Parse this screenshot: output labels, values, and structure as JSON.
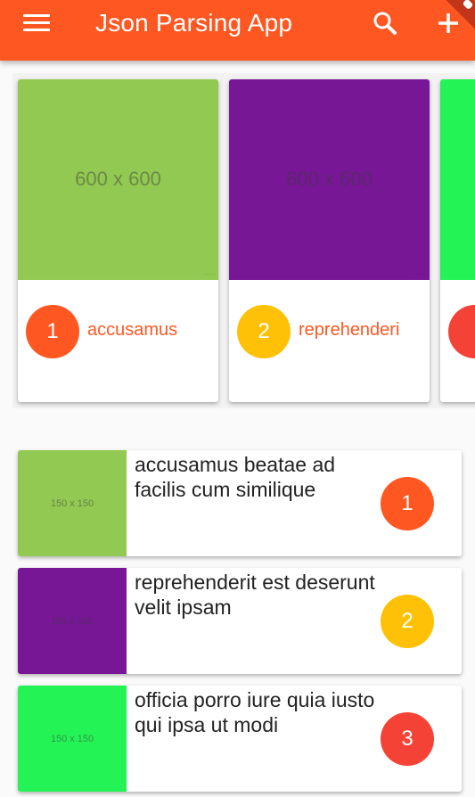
{
  "app_bar": {
    "title": "Json Parsing App",
    "background_color": "#ff5722",
    "icons": [
      "menu-icon",
      "search-icon",
      "add-icon"
    ]
  },
  "colors": {
    "accent": "#ff5722",
    "circle_1": "#ff5722",
    "circle_2": "#ffc107",
    "circle_3": "#f44336"
  },
  "horizontal_cards": [
    {
      "image_text": "600 x 600",
      "image_color": "#92c952",
      "number": "1",
      "label": "accusamus",
      "circle_color": "#ff5722"
    },
    {
      "image_text": "600 x 600",
      "image_color": "#771796",
      "number": "2",
      "label": "reprehenderi",
      "circle_color": "#ffc107"
    },
    {
      "image_text": "",
      "image_color": "#24f355",
      "number": "",
      "label": "",
      "circle_color": "#f44336"
    }
  ],
  "list_items": [
    {
      "thumb_text": "150 x 150",
      "thumb_color": "#92c952",
      "title": "accusamus beatae ad facilis cum similique",
      "number": "1",
      "circle_color": "#ff5722"
    },
    {
      "thumb_text": "150 x 150",
      "thumb_color": "#771796",
      "title": "reprehenderit est deserunt velit ipsam",
      "number": "2",
      "circle_color": "#ffc107"
    },
    {
      "thumb_text": "150 x 150",
      "thumb_color": "#24f355",
      "title": "officia porro iure quia iusto qui ipsa ut modi",
      "number": "3",
      "circle_color": "#f44336"
    }
  ]
}
